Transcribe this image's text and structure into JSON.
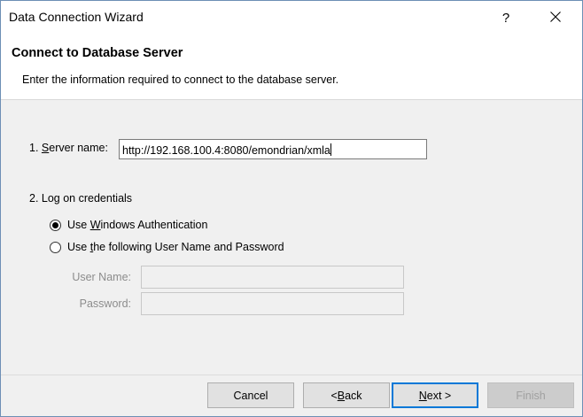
{
  "window": {
    "title": "Data Connection Wizard",
    "help_label": "?"
  },
  "header": {
    "title": "Connect to Database Server",
    "description": "Enter the information required to connect to the database server."
  },
  "server": {
    "label_prefix": "1. ",
    "label_mnemonic": "S",
    "label_rest": "erver name:",
    "value": "http://192.168.100.4:8080/emondrian/xmla"
  },
  "credentials": {
    "heading": "2. Log on credentials",
    "option_windows": {
      "pre": "Use ",
      "mnemonic": "W",
      "post": "indows Authentication",
      "checked": true
    },
    "option_userpass": {
      "pre": "Use ",
      "mnemonic": "t",
      "post": "he following User Name and Password",
      "checked": false
    },
    "username_label": "User Name:",
    "username_value": "",
    "password_label": "Password:",
    "password_value": ""
  },
  "buttons": {
    "cancel": "Cancel",
    "back_pre": "< ",
    "back_mnemonic": "B",
    "back_post": "ack",
    "next_mnemonic": "N",
    "next_post": "ext >",
    "finish": "Finish"
  },
  "colors": {
    "accent": "#0078d7",
    "window_bg": "#f0f0f0",
    "header_bg": "#ffffff",
    "disabled_text": "#8c8c8c"
  }
}
